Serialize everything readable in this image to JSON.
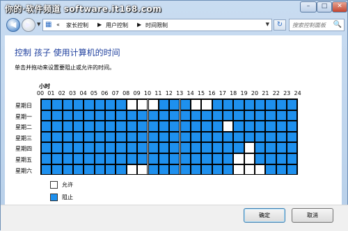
{
  "watermark": "你的·软件频道 software.it168.com",
  "window_controls": {
    "minimize": "–",
    "maximize": "□",
    "close": "✕"
  },
  "nav": {
    "back_glyph": "◀",
    "forward_glyph": "▶",
    "dropdown_glyph": "▼"
  },
  "address": {
    "icon": "control-panel-icon",
    "prefix": "«",
    "crumbs": [
      "家长控制",
      "用户控制",
      "时间限制"
    ],
    "separator": "▶",
    "dropdown_glyph": "▼"
  },
  "refresh_glyph": "↻",
  "search": {
    "placeholder": "搜索控制面板",
    "icon_glyph": "🔍"
  },
  "heading": "控制 孩子 使用计算机的时间",
  "instruction": "单击并拖动来设置要阻止或允许的时间。",
  "hours_title": "小时",
  "hours": [
    "00",
    "01",
    "02",
    "03",
    "04",
    "05",
    "06",
    "07",
    "08",
    "09",
    "10",
    "11",
    "12",
    "13",
    "14",
    "15",
    "16",
    "17",
    "18",
    "19",
    "20",
    "21",
    "22",
    "23",
    "24"
  ],
  "days": [
    "星期日",
    "星期一",
    "星期二",
    "星期三",
    "星期四",
    "星期五",
    "星期六"
  ],
  "schedule": [
    [
      0,
      0,
      0,
      0,
      0,
      0,
      0,
      0,
      1,
      1,
      1,
      0,
      0,
      0,
      1,
      1,
      0,
      0,
      0,
      0,
      0,
      0,
      0,
      0
    ],
    [
      0,
      0,
      0,
      0,
      0,
      0,
      0,
      0,
      0,
      0,
      0,
      0,
      0,
      0,
      0,
      0,
      0,
      0,
      0,
      0,
      0,
      0,
      0,
      0
    ],
    [
      0,
      0,
      0,
      0,
      0,
      0,
      0,
      0,
      0,
      0,
      0,
      0,
      0,
      0,
      0,
      0,
      0,
      1,
      0,
      0,
      0,
      0,
      0,
      0
    ],
    [
      0,
      0,
      0,
      0,
      0,
      0,
      0,
      0,
      0,
      0,
      0,
      0,
      0,
      0,
      0,
      0,
      0,
      0,
      0,
      0,
      0,
      0,
      0,
      0
    ],
    [
      0,
      0,
      0,
      0,
      0,
      0,
      0,
      0,
      0,
      0,
      0,
      0,
      0,
      0,
      0,
      0,
      0,
      0,
      0,
      1,
      0,
      0,
      0,
      0
    ],
    [
      0,
      0,
      0,
      0,
      0,
      0,
      0,
      0,
      0,
      0,
      0,
      0,
      0,
      0,
      0,
      0,
      0,
      0,
      1,
      1,
      0,
      0,
      0,
      0
    ],
    [
      0,
      0,
      0,
      0,
      0,
      0,
      0,
      0,
      1,
      1,
      0,
      0,
      0,
      0,
      0,
      0,
      0,
      0,
      1,
      1,
      1,
      0,
      0,
      0
    ]
  ],
  "legend": {
    "allow": "允许",
    "deny": "阻止"
  },
  "colors": {
    "allow": "#ffffff",
    "deny": "#1e90ee",
    "heading": "#1e3f9e"
  },
  "buttons": {
    "ok": "确定",
    "cancel": "取消"
  }
}
